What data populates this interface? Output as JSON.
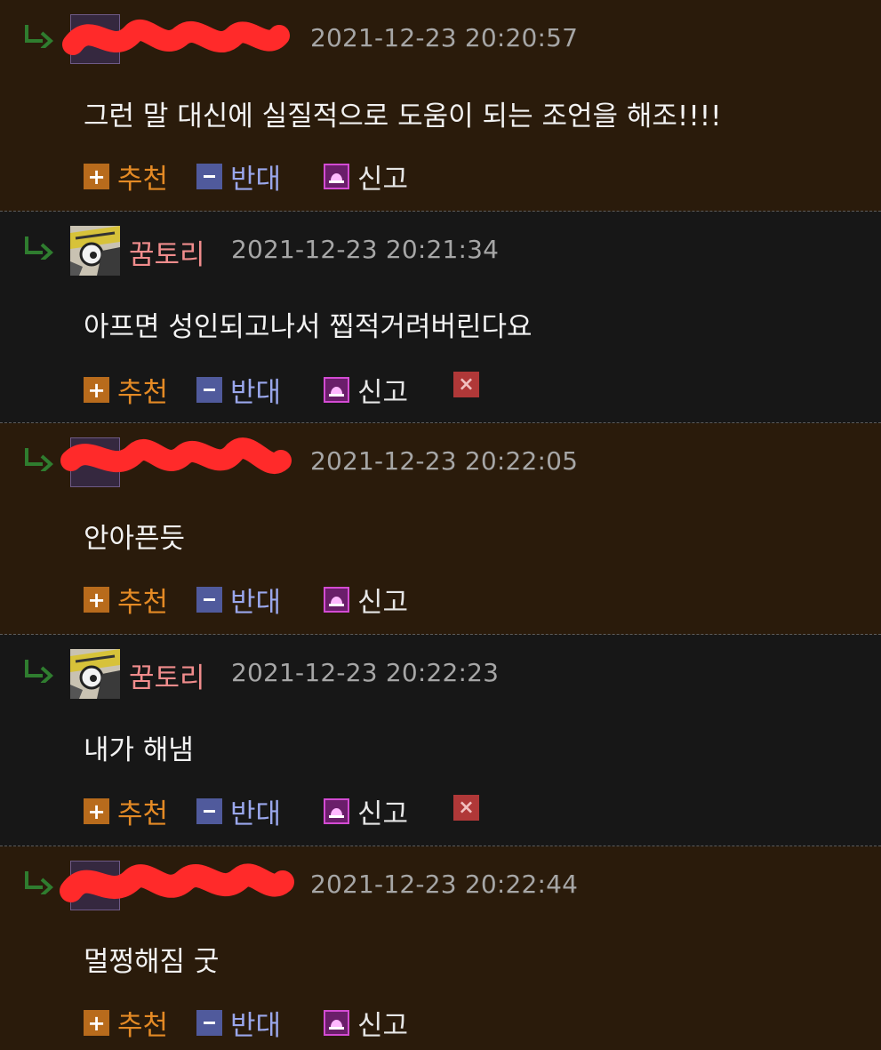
{
  "comments": [
    {
      "timestamp": "2021-12-23 20:20:57",
      "text": "그런 말 대신에 실질적으로 도움이 되는 조언을 해조!!!!",
      "recommend_label": "추천",
      "oppose_label": "반대",
      "report_label": "신고"
    },
    {
      "nickname": "꿈토리",
      "timestamp": "2021-12-23 20:21:34",
      "text": "아프면 성인되고나서 찝적거려버린다요",
      "recommend_label": "추천",
      "oppose_label": "반대",
      "report_label": "신고"
    },
    {
      "timestamp": "2021-12-23 20:22:05",
      "text": "안아픈듯",
      "recommend_label": "추천",
      "oppose_label": "반대",
      "report_label": "신고"
    },
    {
      "nickname": "꿈토리",
      "timestamp": "2021-12-23 20:22:23",
      "text": "내가 해냄",
      "recommend_label": "추천",
      "oppose_label": "반대",
      "report_label": "신고"
    },
    {
      "timestamp": "2021-12-23 20:22:44",
      "text": "멀쩡해짐 굿",
      "recommend_label": "추천",
      "oppose_label": "반대",
      "report_label": "신고"
    }
  ],
  "icons": {
    "reply": "reply-arrow-icon",
    "recommend": "plus-icon",
    "oppose": "minus-icon",
    "report": "siren-icon",
    "delete": "close-icon"
  },
  "colors": {
    "others_comment_bg": "#2a1b0b",
    "own_comment_bg": "#171717",
    "nickname": "#f08c8c",
    "recommend": "#e48a25",
    "oppose": "#9aa7ec",
    "redaction": "#ff2a2a"
  }
}
